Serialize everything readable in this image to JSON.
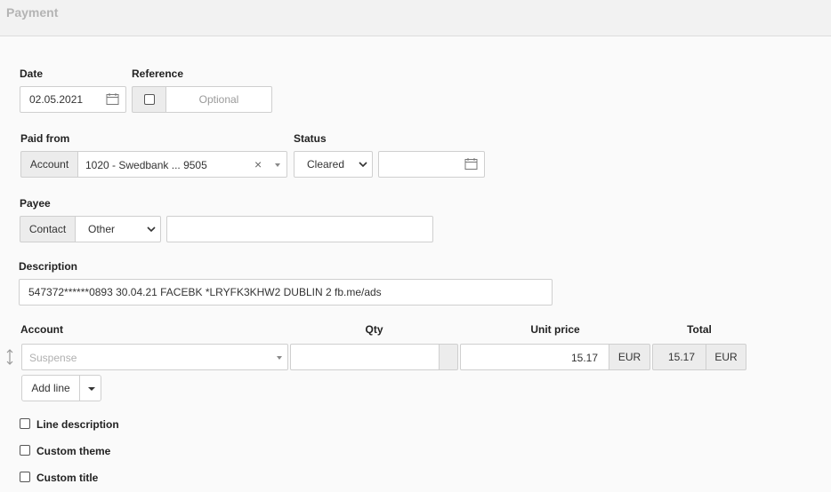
{
  "header": {
    "title": "Payment"
  },
  "date": {
    "label": "Date",
    "value": "02.05.2021"
  },
  "reference": {
    "label": "Reference",
    "placeholder": "Optional"
  },
  "paid_from": {
    "label": "Paid from",
    "addon": "Account",
    "value": "1020 - Swedbank ... 9505",
    "clear": "×"
  },
  "status": {
    "label": "Status",
    "value": "Cleared",
    "date_value": ""
  },
  "payee": {
    "label": "Payee",
    "addon": "Contact",
    "type_value": "Other",
    "name_value": ""
  },
  "description": {
    "label": "Description",
    "value": "547372******0893 30.04.21  FACEBK *LRYFK3KHW2 DUBLIN 2 fb.me/ads"
  },
  "lines": {
    "headers": {
      "account": "Account",
      "qty": "Qty",
      "unit_price": "Unit price",
      "total": "Total"
    },
    "rows": [
      {
        "account_placeholder": "Suspense",
        "qty": "",
        "unit_price": "15.17",
        "unit_currency": "EUR",
        "total": "15.17",
        "total_currency": "EUR"
      }
    ],
    "add_line_label": "Add line"
  },
  "options": [
    {
      "label": "Line description",
      "checked": false
    },
    {
      "label": "Custom theme",
      "checked": false
    },
    {
      "label": "Custom title",
      "checked": false
    }
  ],
  "colors": {
    "background": "#fafafa",
    "header": "#f2f2f2",
    "border": "#cfcfcf",
    "addon": "#ececec"
  }
}
